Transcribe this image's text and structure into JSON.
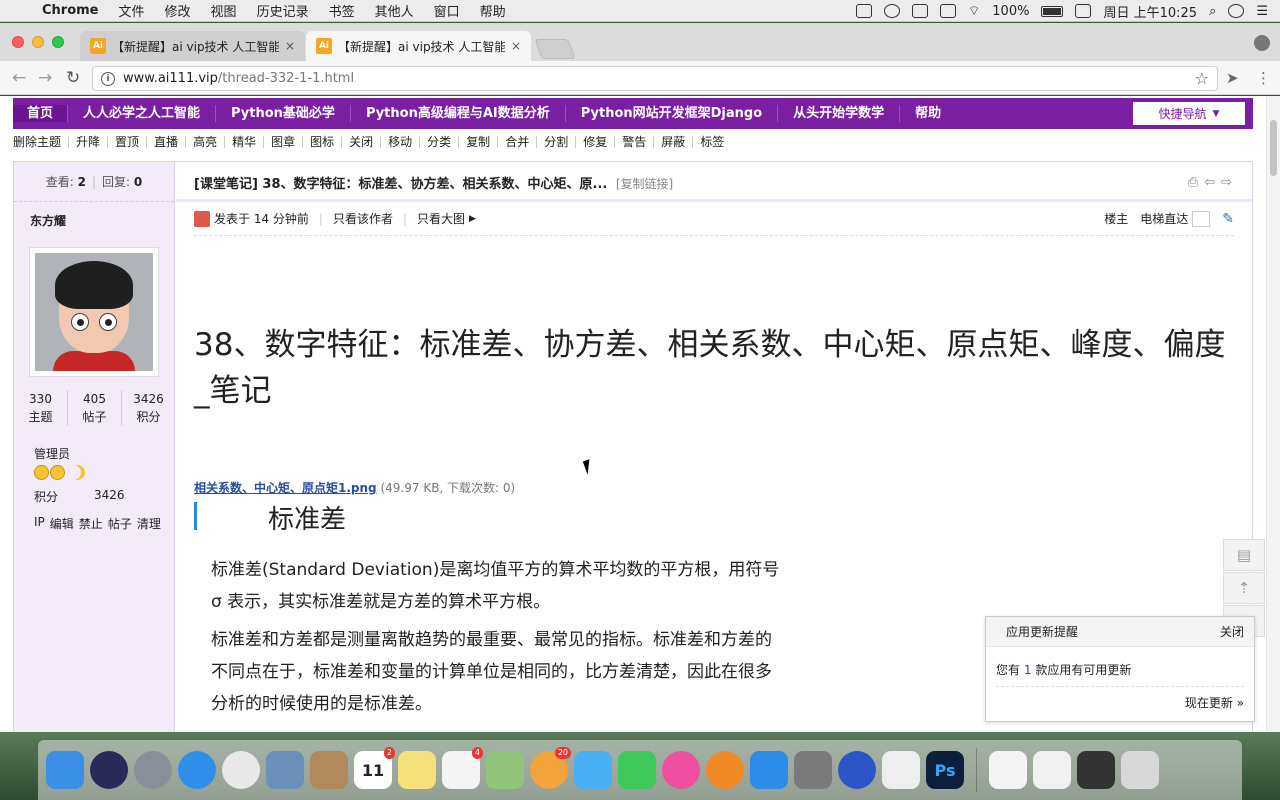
{
  "menubar": {
    "app": "Chrome",
    "items": [
      "文件",
      "修改",
      "视图",
      "历史记录",
      "书签",
      "其他人",
      "窗口",
      "帮助"
    ],
    "battery": "100%",
    "clock": "周日 上午10:25"
  },
  "tabs": [
    {
      "favicon": "Ai",
      "label": "【新提醒】ai vip技术 人工智能",
      "close": "×"
    },
    {
      "favicon": "Ai",
      "label": "【新提醒】ai vip技术 人工智能",
      "close": "×"
    }
  ],
  "address": {
    "host": "www.ai111.vip",
    "path": "/thread-332-1-1.html"
  },
  "navbar": {
    "items": [
      "首页",
      "人人必学之人工智能",
      "Python基础必学",
      "Python高级编程与AI数据分析",
      "Python网站开发框架Django",
      "从头开始学数学",
      "帮助"
    ],
    "quick_nav": "快捷导航"
  },
  "mod_actions": [
    "删除主题",
    "升降",
    "置顶",
    "直播",
    "高亮",
    "精华",
    "图章",
    "图标",
    "关闭",
    "移动",
    "分类",
    "复制",
    "合并",
    "分割",
    "修复",
    "警告",
    "屏蔽",
    "标签"
  ],
  "stats": {
    "views_label": "查看:",
    "views": "2",
    "replies_label": "回复:",
    "replies": "0"
  },
  "thread": {
    "title": "[课堂笔记] 38、数字特征：标准差、协方差、相关系数、中心矩、原...",
    "copy_link": "[复制链接]"
  },
  "post": {
    "posted": "发表于 14 分钟前",
    "only_author": "只看该作者",
    "only_big_image": "只看大图",
    "floor_label": "楼主",
    "elevator": "电梯直达",
    "heading": "38、数字特征：标准差、协方差、相关系数、中心矩、原点矩、峰度、偏度_笔记",
    "attachment": {
      "name": "相关系数、中心矩、原点矩1.png",
      "meta": "(49.97 KB, 下载次数: 0)"
    },
    "image": {
      "heading": "标准差",
      "p1": "标准差(Standard Deviation)是离均值平方的算术平均数的平方根，用符号σ 表示，其实标准差就是方差的算术平方根。",
      "p2": "标准差和方差都是测量离散趋势的最重要、最常见的指标。标准差和方差的不同点在于，标准差和变量的计算单位是相同的，比方差清楚，因此在很多分析的时候使用的是标准差。"
    }
  },
  "author": {
    "name": "东方耀",
    "counts": [
      {
        "value": "330",
        "label": "主题"
      },
      {
        "value": "405",
        "label": "帖子"
      },
      {
        "value": "3426",
        "label": "积分"
      }
    ],
    "role": "管理员",
    "score_label": "积分",
    "score": "3426",
    "links": [
      "IP",
      "编辑",
      "禁止",
      "帖子",
      "清理"
    ]
  },
  "notice": {
    "title": "应用更新提醒",
    "close": "关闭",
    "body_pre": "您有",
    "body_num": "1",
    "body_post": "款应用有可用更新",
    "action": "现在更新 »"
  },
  "dock": {
    "apps": [
      {
        "name": "finder",
        "color": "#3b8fe6"
      },
      {
        "name": "siri",
        "color": "#2a2a5a"
      },
      {
        "name": "launchpad",
        "color": "#8a8f99"
      },
      {
        "name": "safari",
        "color": "#2d8fe8"
      },
      {
        "name": "chrome",
        "color": "#e8e8e8"
      },
      {
        "name": "mail-stamp",
        "color": "#6a8fb8"
      },
      {
        "name": "contacts",
        "color": "#b08a5c"
      },
      {
        "name": "calendar",
        "color": "#ffffff",
        "text": "11",
        "badge": "2"
      },
      {
        "name": "notes",
        "color": "#f5e07a"
      },
      {
        "name": "reminders",
        "color": "#f4f4f4",
        "badge": "4"
      },
      {
        "name": "maps",
        "color": "#8fc47a"
      },
      {
        "name": "photos",
        "color": "#f2a33c",
        "badge": "20"
      },
      {
        "name": "messages",
        "color": "#4ab0f5"
      },
      {
        "name": "facetime",
        "color": "#3ec95a"
      },
      {
        "name": "itunes",
        "color": "#f04fa0"
      },
      {
        "name": "ibooks",
        "color": "#f08a24"
      },
      {
        "name": "app-store",
        "color": "#2b8de8"
      },
      {
        "name": "system-preferences",
        "color": "#7a7a7a"
      },
      {
        "name": "screenflow",
        "color": "#2c55c8"
      },
      {
        "name": "textedit",
        "color": "#eeeeee"
      },
      {
        "name": "photoshop",
        "color": "#0d1f3a",
        "text": "Ps"
      }
    ],
    "right": [
      {
        "name": "document",
        "color": "#f4f4f4"
      },
      {
        "name": "document-2",
        "color": "#f0f0f0"
      },
      {
        "name": "screen-ps",
        "color": "#333333"
      },
      {
        "name": "trash",
        "color": "#d8d8d8"
      }
    ]
  }
}
